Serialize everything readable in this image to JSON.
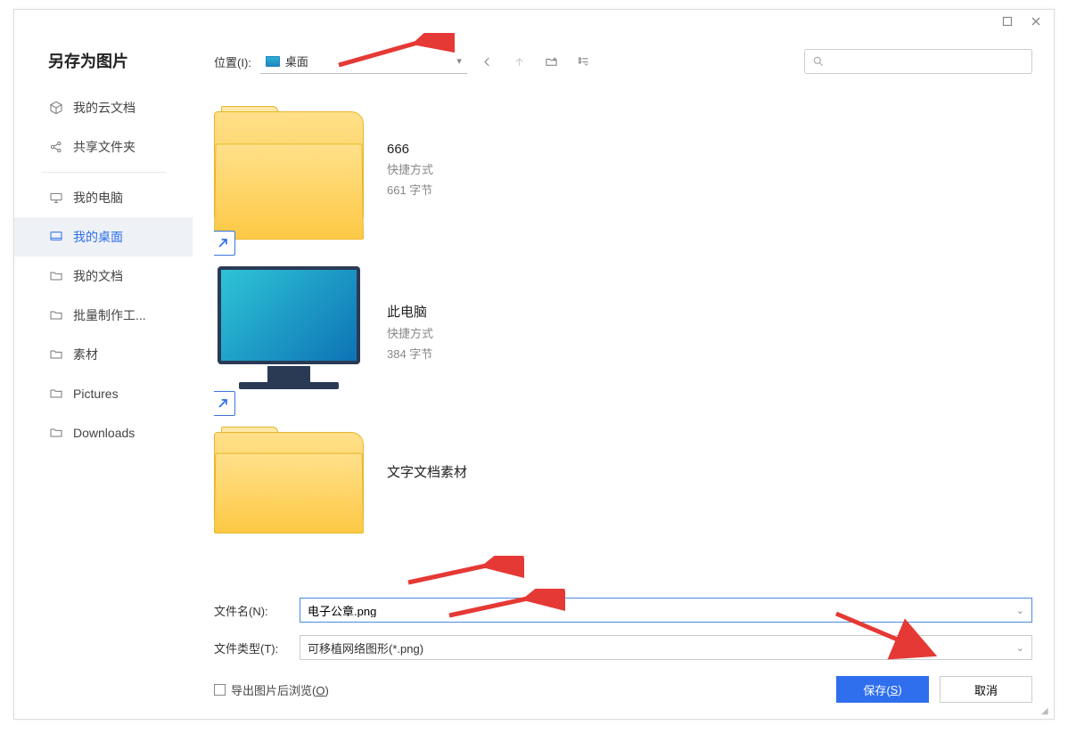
{
  "dialog": {
    "title": "另存为图片"
  },
  "sidebar": {
    "items": [
      {
        "label": "我的云文档",
        "icon": "cube"
      },
      {
        "label": "共享文件夹",
        "icon": "share"
      },
      {
        "label": "我的电脑",
        "icon": "computer"
      },
      {
        "label": "我的桌面",
        "icon": "desktop",
        "selected": true
      },
      {
        "label": "我的文档",
        "icon": "folder"
      },
      {
        "label": "批量制作工...",
        "icon": "folder"
      },
      {
        "label": "素材",
        "icon": "folder"
      },
      {
        "label": "Pictures",
        "icon": "folder"
      },
      {
        "label": "Downloads",
        "icon": "folder"
      }
    ]
  },
  "toolbar": {
    "location_label": "位置(I):",
    "location_value": "桌面",
    "search_placeholder": ""
  },
  "files": [
    {
      "name": "666",
      "sub1": "快捷方式",
      "sub2": "661 字节",
      "type": "folder",
      "shortcut": true
    },
    {
      "name": "此电脑",
      "sub1": "快捷方式",
      "sub2": "384 字节",
      "type": "computer",
      "shortcut": true
    },
    {
      "name": "文字文档素材",
      "sub1": "",
      "sub2": "",
      "type": "folder",
      "shortcut": false
    }
  ],
  "form": {
    "filename_label": "文件名(N):",
    "filename_value": "电子公章.png",
    "filetype_label": "文件类型(T):",
    "filetype_value": "可移植网络图形(*.png)",
    "checkbox_label_pre": "导出图片后浏览(",
    "checkbox_label_key": "O",
    "checkbox_label_post": ")",
    "save_pre": "保存(",
    "save_key": "S",
    "save_post": ")",
    "cancel_label": "取消"
  }
}
